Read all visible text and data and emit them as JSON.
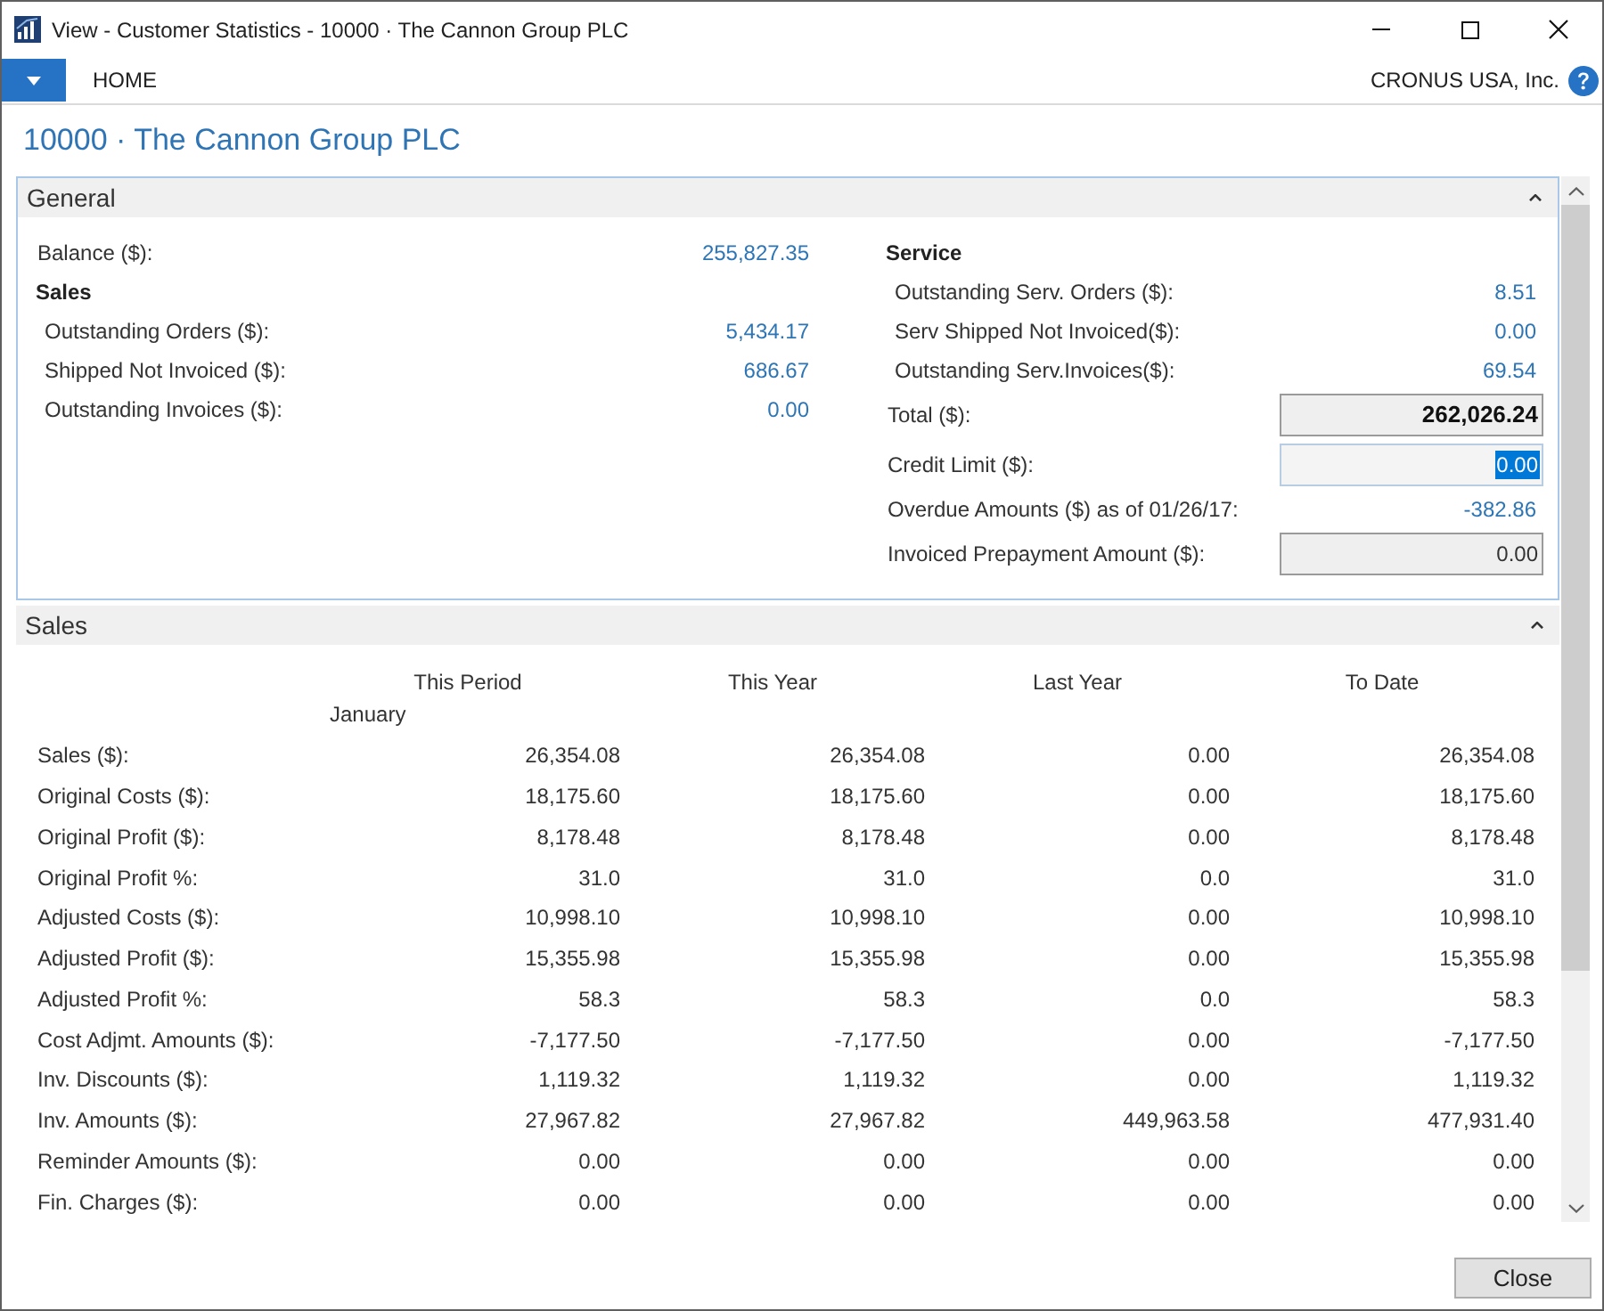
{
  "window": {
    "title": "View - Customer Statistics - 10000 · The Cannon Group PLC"
  },
  "ribbon": {
    "tabs": [
      "HOME"
    ],
    "company": "CRONUS USA, Inc."
  },
  "page_title": "10000 · The Cannon Group PLC",
  "general": {
    "title": "General",
    "expanded": true,
    "left": [
      {
        "kind": "link",
        "label": "Balance ($):",
        "value": "255,827.35"
      },
      {
        "kind": "group",
        "label": "Sales",
        "children": [
          {
            "kind": "link",
            "label": "Outstanding Orders ($):",
            "value": "5,434.17"
          },
          {
            "kind": "link",
            "label": "Shipped Not Invoiced ($):",
            "value": "686.67"
          },
          {
            "kind": "link",
            "label": "Outstanding Invoices ($):",
            "value": "0.00"
          }
        ]
      }
    ],
    "right": [
      {
        "kind": "group",
        "label": "Service",
        "children": [
          {
            "kind": "link",
            "label": "Outstanding Serv. Orders ($):",
            "value": "8.51"
          },
          {
            "kind": "link",
            "label": "Serv Shipped Not Invoiced($):",
            "value": "0.00"
          },
          {
            "kind": "link",
            "label": "Outstanding Serv.Invoices($):",
            "value": "69.54"
          }
        ]
      },
      {
        "kind": "box",
        "label": "Total ($):",
        "value": "262,026.24",
        "bold": true,
        "selected": false
      },
      {
        "kind": "box",
        "label": "Credit Limit ($):",
        "value": "0.00",
        "bold": false,
        "selected": true
      },
      {
        "kind": "link",
        "label": "Overdue Amounts ($) as of 01/26/17:",
        "value": "-382.86"
      },
      {
        "kind": "box",
        "label": "Invoiced Prepayment Amount ($):",
        "value": "0.00",
        "bold": false,
        "selected": false
      }
    ]
  },
  "sales": {
    "title": "Sales",
    "expanded": true,
    "columns": [
      {
        "label": "This Period",
        "period": "January"
      },
      {
        "label": "This Year"
      },
      {
        "label": "Last Year"
      },
      {
        "label": "To Date"
      }
    ],
    "rows": [
      {
        "label": "Sales ($):",
        "values": [
          "26,354.08",
          "26,354.08",
          "0.00",
          "26,354.08"
        ]
      },
      {
        "label": "Original Costs ($):",
        "values": [
          "18,175.60",
          "18,175.60",
          "0.00",
          "18,175.60"
        ]
      },
      {
        "label": "Original Profit ($):",
        "values": [
          "8,178.48",
          "8,178.48",
          "0.00",
          "8,178.48"
        ]
      },
      {
        "label": "Original Profit %:",
        "values": [
          "31.0",
          "31.0",
          "0.0",
          "31.0"
        ]
      },
      {
        "label": "Adjusted Costs ($):",
        "values": [
          "10,998.10",
          "10,998.10",
          "0.00",
          "10,998.10"
        ]
      },
      {
        "label": "Adjusted Profit ($):",
        "values": [
          "15,355.98",
          "15,355.98",
          "0.00",
          "15,355.98"
        ]
      },
      {
        "label": "Adjusted Profit %:",
        "values": [
          "58.3",
          "58.3",
          "0.0",
          "58.3"
        ]
      },
      {
        "label": "Cost Adjmt. Amounts ($):",
        "values": [
          "-7,177.50",
          "-7,177.50",
          "0.00",
          "-7,177.50"
        ]
      },
      {
        "label": "Inv. Discounts ($):",
        "values": [
          "1,119.32",
          "1,119.32",
          "0.00",
          "1,119.32"
        ]
      },
      {
        "label": "Inv. Amounts ($):",
        "values": [
          "27,967.82",
          "27,967.82",
          "449,963.58",
          "477,931.40"
        ]
      },
      {
        "label": "Reminder Amounts ($):",
        "values": [
          "0.00",
          "0.00",
          "0.00",
          "0.00"
        ]
      },
      {
        "label": "Fin. Charges ($):",
        "values": [
          "0.00",
          "0.00",
          "0.00",
          "0.00"
        ]
      }
    ]
  },
  "buttons": [
    "Close"
  ]
}
